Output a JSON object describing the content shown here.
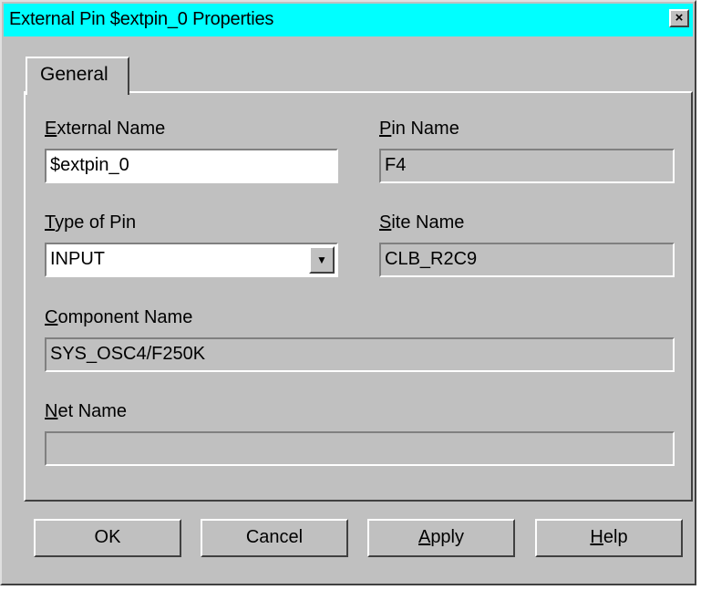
{
  "window": {
    "title": "External Pin $extpin_0 Properties",
    "close_glyph": "×",
    "titlebar_color": "#00ffff"
  },
  "tabs": [
    {
      "label": "General"
    }
  ],
  "fields": {
    "external_name": {
      "mnemonic": "E",
      "label_rest": "xternal Name",
      "value": "$extpin_0"
    },
    "pin_name": {
      "mnemonic": "P",
      "label_rest": "in Name",
      "value": "F4"
    },
    "type_of_pin": {
      "mnemonic": "T",
      "label_rest": "ype of Pin",
      "value": "INPUT",
      "dropdown_icon": "chevron-down-icon"
    },
    "site_name": {
      "mnemonic": "S",
      "label_rest": "ite Name",
      "value": "CLB_R2C9"
    },
    "component_name": {
      "mnemonic": "C",
      "label_rest": "omponent Name",
      "value": "SYS_OSC4/F250K"
    },
    "net_name": {
      "mnemonic": "N",
      "label_rest": "et Name",
      "value": ""
    }
  },
  "buttons": {
    "ok": {
      "label": "OK"
    },
    "cancel": {
      "label": "Cancel"
    },
    "apply": {
      "mnemonic": "A",
      "label_rest": "pply"
    },
    "help": {
      "mnemonic": "H",
      "label_rest": "elp"
    }
  }
}
